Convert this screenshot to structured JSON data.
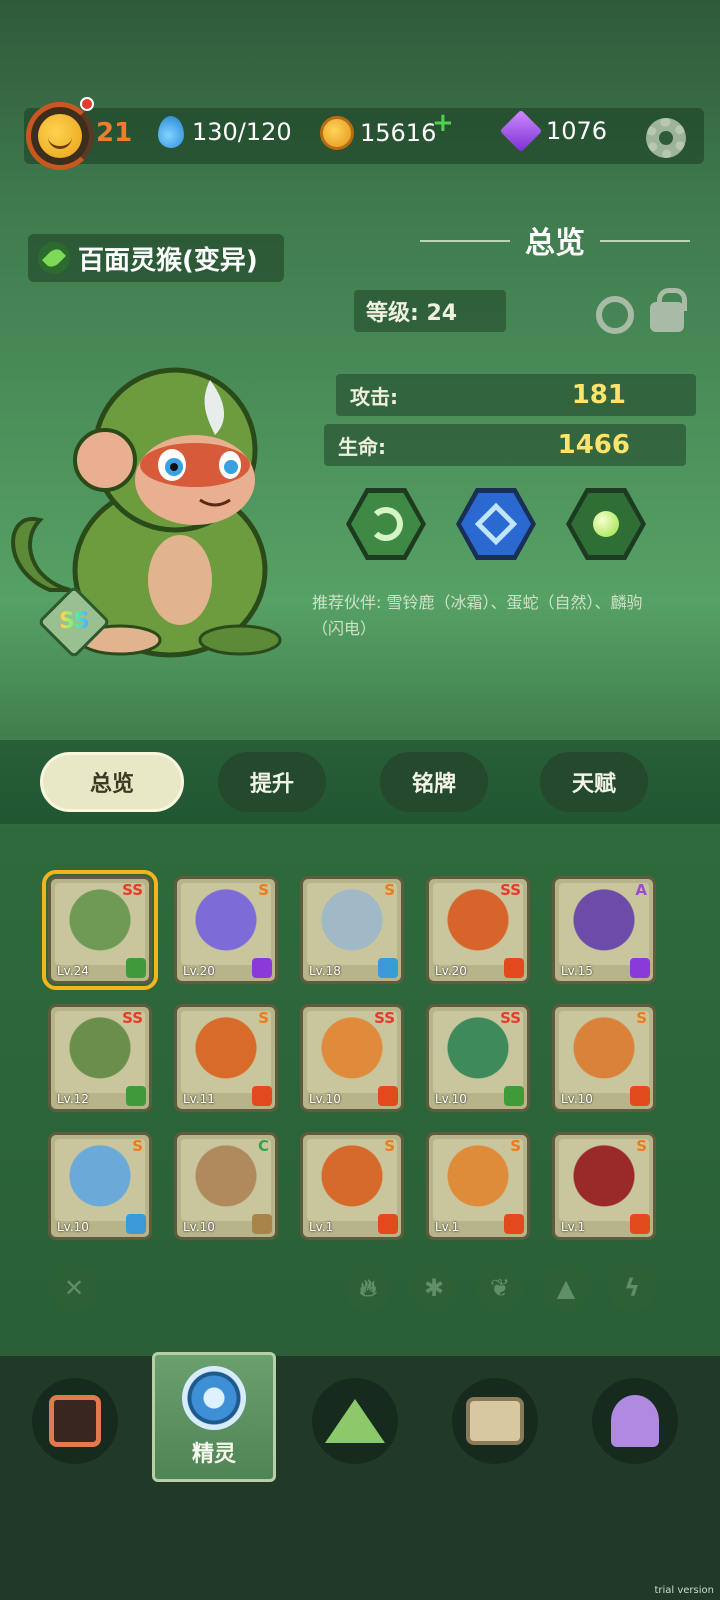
{
  "header": {
    "player_level": "21",
    "energy": "130/120",
    "coins": "15616",
    "plus": "+",
    "gems": "1076",
    "avatar_icon": "smiling-sun-avatar",
    "energy_icon": "water-drop-icon",
    "coin_icon": "paw-coin-icon",
    "gem_icon": "purple-gem-icon",
    "settings_icon": "gear-icon"
  },
  "pet": {
    "name": "百面灵猴(变异)",
    "element_icon": "leaf-icon",
    "rank": "SS"
  },
  "overview": {
    "title": "总览",
    "level_label": "等级: 24",
    "attack_label": "攻击:",
    "attack_value": "181",
    "hp_label": "生命:",
    "hp_value": "1466",
    "skills": [
      "wind-blade-icon",
      "blue-crystal-icon",
      "green-orb-icon"
    ],
    "recommend": "推荐伙伴: 雪铃鹿（冰霜）、蛋蛇（自然）、麟驹（闪电）"
  },
  "tabs": [
    "总览",
    "提升",
    "铭牌",
    "天赋"
  ],
  "roster": [
    {
      "lv": "Lv.24",
      "rank": "SS",
      "element": "nature",
      "color": "#6f9a56"
    },
    {
      "lv": "Lv.20",
      "rank": "S",
      "element": "lightning",
      "color": "#7d6bd8"
    },
    {
      "lv": "Lv.18",
      "rank": "S",
      "element": "ice",
      "color": "#9fb9c7"
    },
    {
      "lv": "Lv.20",
      "rank": "SS",
      "element": "fire",
      "color": "#d7642a"
    },
    {
      "lv": "Lv.15",
      "rank": "A",
      "element": "lightning",
      "color": "#6c4ca8"
    },
    {
      "lv": "Lv.12",
      "rank": "SS",
      "element": "nature",
      "color": "#6a8e4c"
    },
    {
      "lv": "Lv.11",
      "rank": "S",
      "element": "fire",
      "color": "#d86a2a"
    },
    {
      "lv": "Lv.10",
      "rank": "SS",
      "element": "fire",
      "color": "#e08a3c"
    },
    {
      "lv": "Lv.10",
      "rank": "SS",
      "element": "nature",
      "color": "#3f8a5a"
    },
    {
      "lv": "Lv.10",
      "rank": "S",
      "element": "fire",
      "color": "#d9823a"
    },
    {
      "lv": "Lv.10",
      "rank": "S",
      "element": "ice",
      "color": "#6aa9d8"
    },
    {
      "lv": "Lv.10",
      "rank": "C",
      "element": "earth",
      "color": "#b08a5c"
    },
    {
      "lv": "Lv.1",
      "rank": "S",
      "element": "fire",
      "color": "#d56a2a"
    },
    {
      "lv": "Lv.1",
      "rank": "S",
      "element": "fire",
      "color": "#de8c3a"
    },
    {
      "lv": "Lv.1",
      "rank": "S",
      "element": "fire",
      "color": "#9a2a2a"
    }
  ],
  "filters": [
    "clear-filter-icon",
    "fire-filter-icon",
    "ice-filter-icon",
    "nature-filter-icon",
    "earth-filter-icon",
    "lightning-filter-icon"
  ],
  "nav": {
    "items": [
      "backpack-icon",
      "spirit-icon",
      "mountain-icon",
      "chest-icon",
      "map-pin-icon"
    ],
    "active_label": "精灵"
  },
  "watermark": "trial version"
}
